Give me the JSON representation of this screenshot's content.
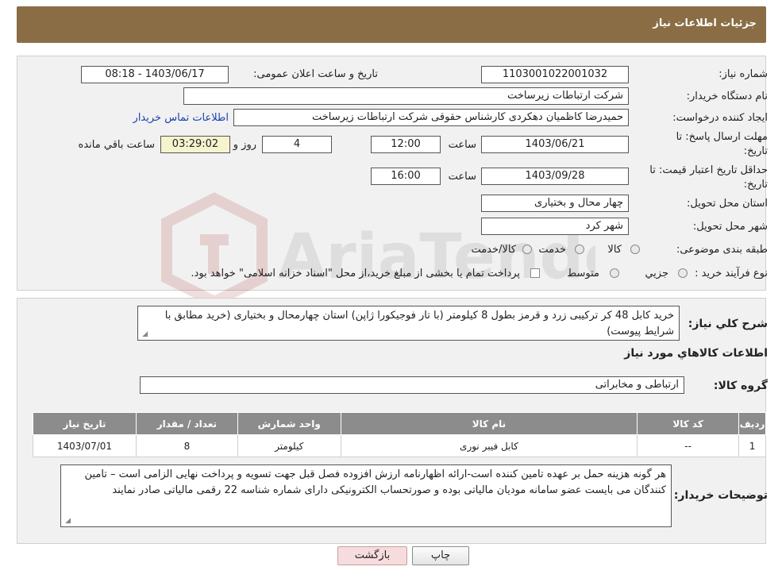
{
  "header": {
    "title": "جزئیات اطلاعات نیاز"
  },
  "need_info": {
    "need_number_label": "شماره نیاز:",
    "need_number": "1103001022001032",
    "announce_label": "تاریخ و ساعت اعلان عمومی:",
    "announce_value": "1403/06/17 - 08:18",
    "buyer_org_label": "نام دستگاه خریدار:",
    "buyer_org": "شرکت ارتباطات زیرساخت",
    "creator_label": "ایجاد کننده درخواست:",
    "creator": "حمیدرضا کاظمیان دهکردی کارشناس حقوقی شرکت ارتباطات زیرساخت",
    "contact_link": "اطلاعات تماس خریدار",
    "deadline_label_1": "مهلت ارسال پاسخ: تا",
    "deadline_label_2": "تاریخ:",
    "deadline_date": "1403/06/21",
    "time_label": "ساعت",
    "deadline_time": "12:00",
    "days_value": "4",
    "days_label": "روز و",
    "remaining_time": "03:29:02",
    "remaining_label": "ساعت باقي مانده",
    "validity_label_1": "حداقل تاریخ اعتبار قیمت: تا",
    "validity_label_2": "تاریخ:",
    "validity_date": "1403/09/28",
    "validity_time": "16:00",
    "province_label": "استان محل تحویل:",
    "province": "چهار محال و بختیاری",
    "city_label": "شهر محل تحویل:",
    "city": "شهر کرد",
    "category_label": "طبقه بندی موضوعی:",
    "category_options": [
      "کالا",
      "خدمت",
      "کالا/خدمت"
    ],
    "process_label": "نوع فرآیند خرید :",
    "process_options": [
      "جزیي",
      "متوسط"
    ],
    "payment_note": "پرداخت تمام یا بخشی از مبلغ خرید،از محل \"اسناد خزانه اسلامی\" خواهد بود."
  },
  "description": {
    "label": "شرح کلي نياز:",
    "text": "خرید کابل 48 کر ترکیبی زرد و قرمز بطول 8 کیلومتر (با تار فوجیکورا ژاپن)  استان چهارمحال و بختیاری (خرید مطابق با شرایط پیوست)"
  },
  "goods_section": {
    "title": "اطلاعات کالاهاي مورد نياز",
    "group_label": "گروه کالا:",
    "group_value": "ارتباطی و مخابراتی"
  },
  "table": {
    "headers": [
      "رديف",
      "کد کالا",
      "نام کالا",
      "واحد شمارش",
      "تعداد / مقدار",
      "تاریخ نیاز"
    ],
    "rows": [
      [
        "1",
        "--",
        "کابل فیبر نوری",
        "کیلومتر",
        "8",
        "1403/07/01"
      ]
    ]
  },
  "buyer_notes": {
    "label": "توضیحات خریدار:",
    "text": "هر گونه هزینه حمل بر عهده تامین کننده است-ارائه اظهارنامه ارزش افزوده فصل قبل جهت تسویه و پرداخت نهایی الزامی است  – تامین کنندگان می بایست  عضو سامانه مودیان مالیاتی بوده و صورتحساب الکترونیکی دارای شماره شناسه 22 رقمی مالیاتی  صادر نمایند"
  },
  "buttons": {
    "print": "چاپ",
    "back": "بازگشت"
  },
  "watermark": {
    "text": "AriaTender.neT"
  },
  "colors": {
    "header": "#8a6d44",
    "link": "#1a3fb0",
    "table_header": "#8c8c8c",
    "back_button": "#f6dcdc"
  }
}
